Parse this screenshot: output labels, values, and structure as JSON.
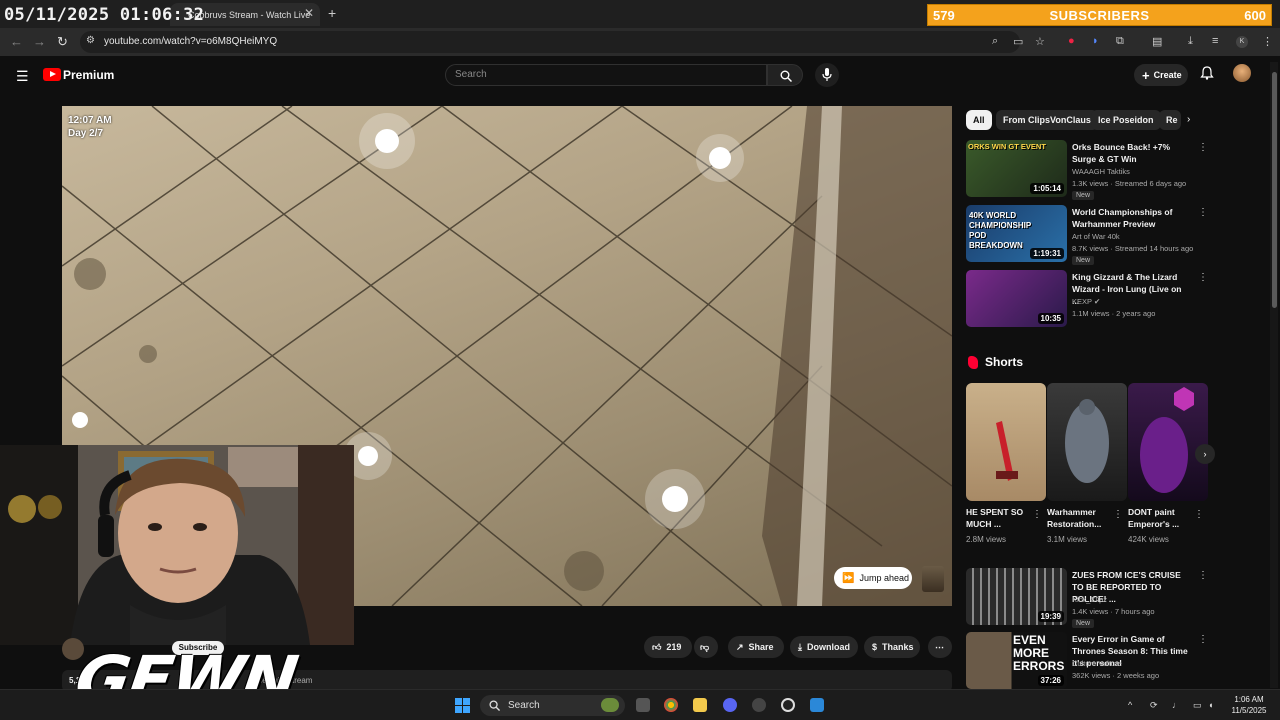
{
  "overlay": {
    "clock": "05/11/2025 01:06:32",
    "subscriber_goal": {
      "current": "579",
      "label": "SUBSCRIBERS",
      "goal": "600",
      "progress_fraction": 0.965
    },
    "webcam_logo_text": "GEWN"
  },
  "browser": {
    "tab_title": "Cobbruvs Stream - Watch Live",
    "url": "youtube.com/watch?v=o6M8QHeiMYQ",
    "accent": "#f4a21c"
  },
  "youtube": {
    "brand": "Premium",
    "search_placeholder": "Search",
    "create_label": "Create"
  },
  "player": {
    "time_overlay": "12:07 AM",
    "day_overlay": "Day 2/7",
    "jump_ahead": "Jump ahead"
  },
  "below_player": {
    "subscribe": "Subscribe",
    "views_partial": "5,1",
    "tag_partial": "#icecruisestream",
    "actions": {
      "likes": "219",
      "share": "Share",
      "download": "Download",
      "thanks": "Thanks"
    }
  },
  "chips": [
    "All",
    "From ClipsVonClaus",
    "Ice Poseidon",
    "Re"
  ],
  "recommendations_top": [
    {
      "title": "Orks Bounce Back! +7% Surge & GT Win",
      "channel": "WAAAGH Taktiks",
      "meta": "1.3K views · Streamed 6 days ago",
      "badge": "New",
      "duration": "1:05:14",
      "thumb_text": "ORKS WIN GT EVENT"
    },
    {
      "title": "World Championships of Warhammer Preview",
      "channel": "Art of War 40k",
      "meta": "8.7K views · Streamed 14 hours ago",
      "badge": "New",
      "duration": "1:19:31",
      "thumb_text": "40K WORLD CHAMPIONSHIP POD BREAKDOWN"
    },
    {
      "title": "King Gizzard & The Lizard Wizard - Iron Lung (Live on ...",
      "channel": "KEXP",
      "meta": "1.1M views · 2 years ago",
      "badge": "",
      "duration": "10:35",
      "thumb_text": ""
    }
  ],
  "shorts": {
    "heading": "Shorts",
    "items": [
      {
        "title": "HE SPENT SO MUCH ...",
        "views": "2.8M views"
      },
      {
        "title": "Warhammer Restoration...",
        "views": "3.1M views"
      },
      {
        "title": "DONT paint Emperor's ...",
        "views": "424K views"
      }
    ]
  },
  "recommendations_bottom": [
    {
      "title": "ZUES FROM ICE'S CRUISE TO BE REPORTED TO POLICE! ...",
      "channel": "Kick_Clipz",
      "meta": "1.4K views · 7 hours ago",
      "badge": "New",
      "duration": "19:39"
    },
    {
      "title": "Every Error in Game of Thrones Season 8: This time it's personal",
      "channel": "Culture Vulture",
      "meta": "362K views · 2 weeks ago",
      "badge": "",
      "duration": "37:26",
      "thumb_text": "EVEN MORE ERRORS"
    }
  ],
  "taskbar": {
    "search_label": "Search",
    "time": "1:06 AM",
    "date": "11/5/2025"
  }
}
